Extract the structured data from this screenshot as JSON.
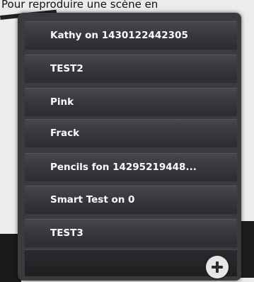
{
  "background": {
    "top_text": "Pour reproduire une scène en"
  },
  "menu": {
    "items": [
      {
        "label": "Kathy on 1430122442305"
      },
      {
        "label": "TEST2"
      },
      {
        "label": "Pink"
      },
      {
        "label": "Frack"
      },
      {
        "label": "Pencils fon 14295219448..."
      },
      {
        "label": "Smart Test on 0"
      },
      {
        "label": "TEST3"
      }
    ],
    "add_icon": "plus-icon"
  },
  "colors": {
    "panel": "#3a3b3e",
    "item_text": "#ffffff",
    "add_button": "#e6e6e6"
  }
}
